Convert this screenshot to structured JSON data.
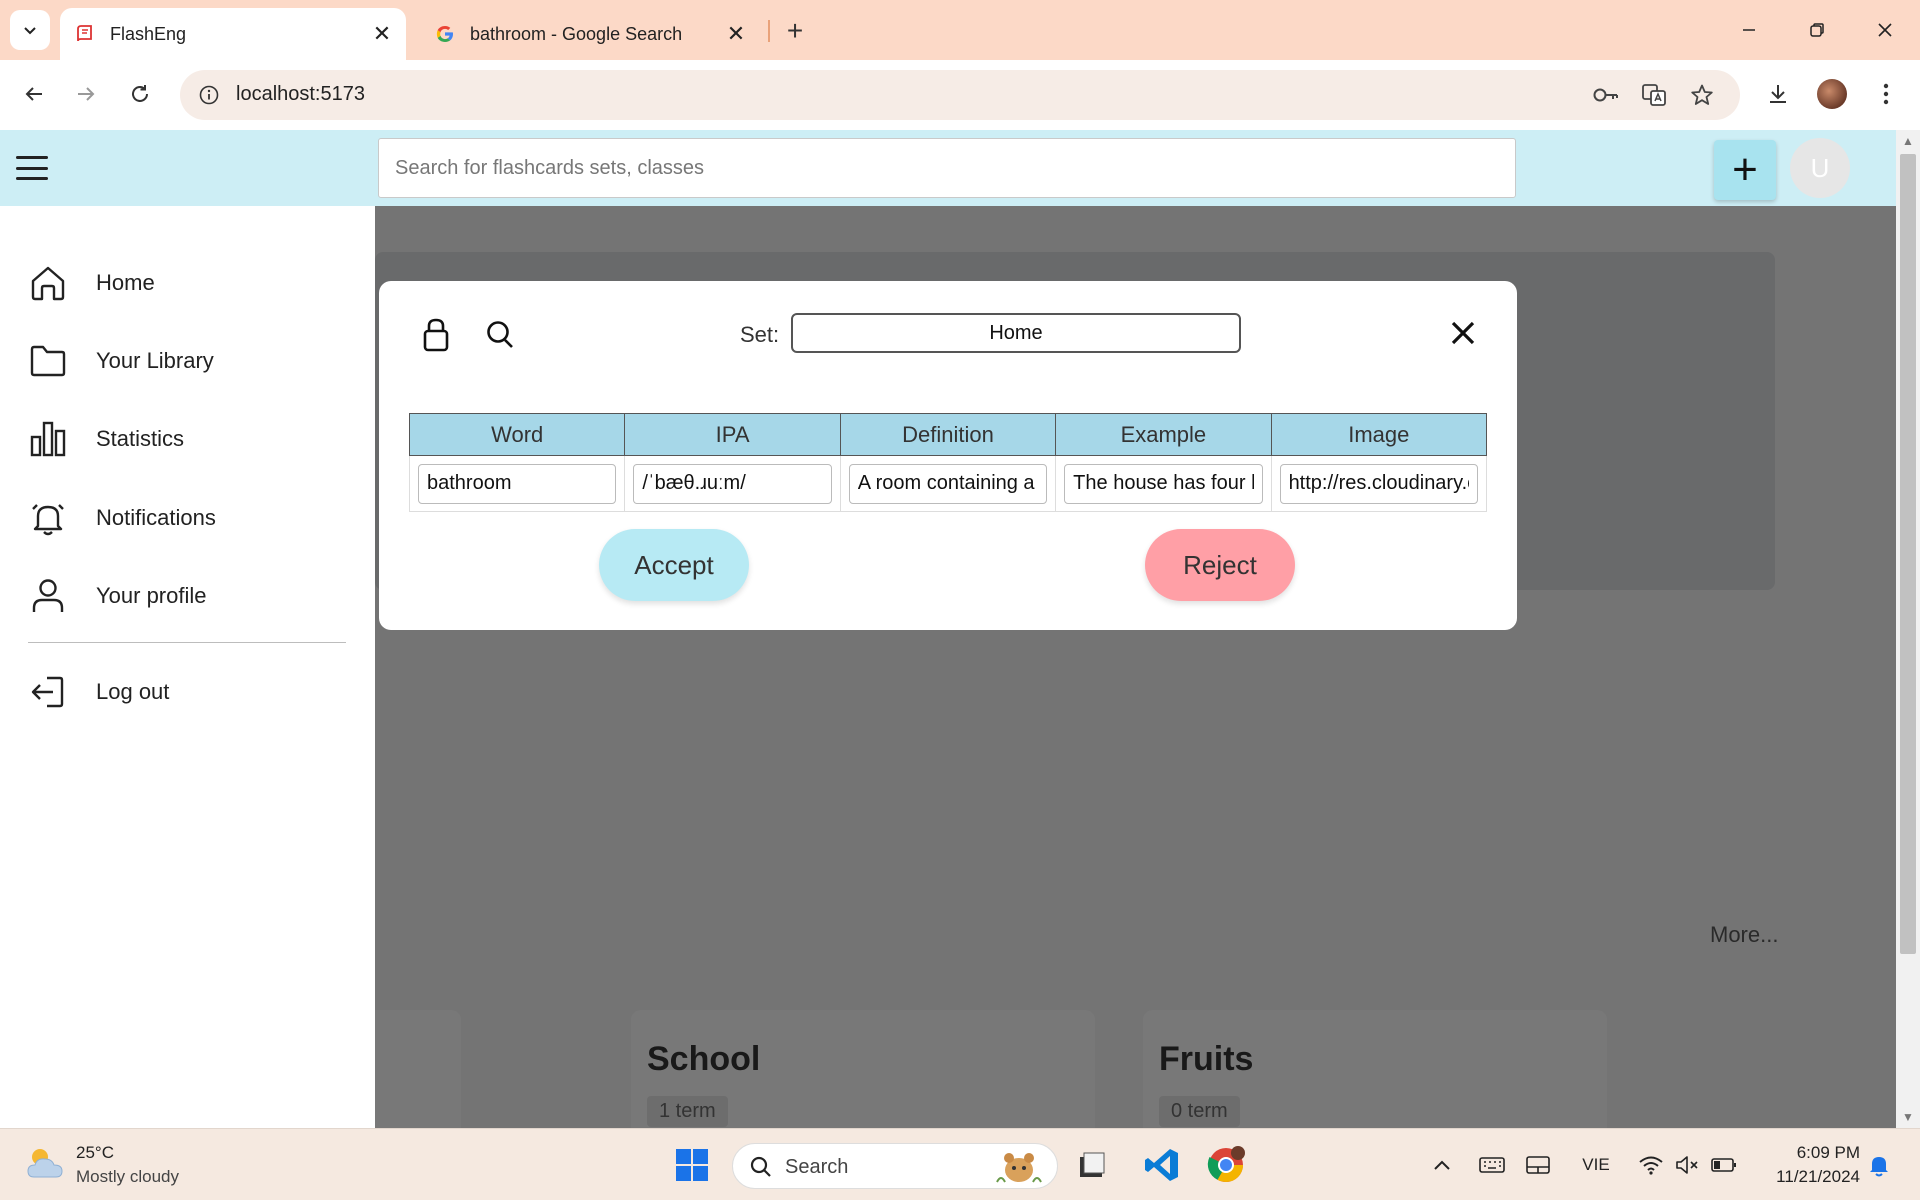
{
  "browser": {
    "tabs": [
      {
        "title": "FlashEng",
        "active": true
      },
      {
        "title": "bathroom - Google Search",
        "active": false
      }
    ],
    "url": "localhost:5173"
  },
  "app": {
    "search_placeholder": "Search for flashcards sets, classes",
    "add_label": "+",
    "user_initial": "U"
  },
  "sidebar": {
    "items": [
      {
        "label": "Home",
        "icon": "home-icon"
      },
      {
        "label": "Your Library",
        "icon": "folder-icon"
      },
      {
        "label": "Statistics",
        "icon": "bar-chart-icon"
      },
      {
        "label": "Notifications",
        "icon": "bell-icon"
      },
      {
        "label": "Your profile",
        "icon": "person-icon"
      },
      {
        "label": "Log out",
        "icon": "logout-icon"
      }
    ]
  },
  "main": {
    "more_label": "More...",
    "cards": [
      {
        "title": "School",
        "terms": "1 term"
      },
      {
        "title": "Fruits",
        "terms": "0 term"
      }
    ]
  },
  "modal": {
    "set_label": "Set:",
    "set_value": "Home",
    "columns": [
      "Word",
      "IPA",
      "Definition",
      "Example",
      "Image"
    ],
    "row": {
      "word": "bathroom",
      "ipa": "/ˈbæθ.ɹuːm/",
      "definition": "A room containing a",
      "example": "The house has four b",
      "image": "http://res.cloudinary.c"
    },
    "accept_label": "Accept",
    "reject_label": "Reject"
  },
  "taskbar": {
    "weather_temp": "25°C",
    "weather_desc": "Mostly cloudy",
    "search_label": "Search",
    "language": "VIE",
    "time": "6:09 PM",
    "date": "11/21/2024"
  },
  "colors": {
    "tabbar_bg": "#fcd9c7",
    "app_header_bg": "#cdeef5",
    "table_header_bg": "#a6d7e8",
    "accept_bg": "#b7eaf4",
    "reject_bg": "#ff9fa6"
  }
}
